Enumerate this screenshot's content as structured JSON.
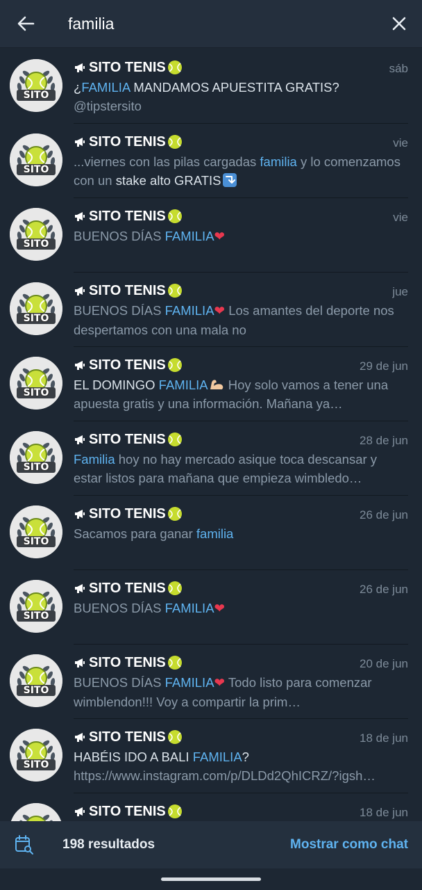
{
  "header": {
    "search_value": "familia",
    "back_icon": "arrow-left-icon",
    "close_icon": "close-icon"
  },
  "results": [
    {
      "chat_name": "SITO TENIS",
      "date": "sáb",
      "avatar_text": "SITO",
      "parts": [
        {
          "t": "¿",
          "c": "white"
        },
        {
          "t": "FAMILIA",
          "c": "hl"
        },
        {
          "t": " MANDAMOS APUESTITA GRATIS?",
          "c": "white"
        },
        {
          "t": " @tipstersito",
          "c": ""
        }
      ]
    },
    {
      "chat_name": "SITO TENIS",
      "date": "vie",
      "avatar_text": "SITO",
      "parts": [
        {
          "t": "...viernes con las pilas cargadas ",
          "c": ""
        },
        {
          "t": "familia",
          "c": "hl"
        },
        {
          "t": " y lo comenzamos con un ",
          "c": ""
        },
        {
          "t": "stake alto GRATIS",
          "c": "white"
        },
        {
          "t": "",
          "c": "arrow"
        }
      ]
    },
    {
      "chat_name": "SITO TENIS",
      "date": "vie",
      "avatar_text": "SITO",
      "parts": [
        {
          "t": "BUENOS DÍAS ",
          "c": ""
        },
        {
          "t": "FAMILIA",
          "c": "hl"
        },
        {
          "t": "❤",
          "c": "heart"
        }
      ]
    },
    {
      "chat_name": "SITO TENIS",
      "date": "jue",
      "avatar_text": "SITO",
      "parts": [
        {
          "t": "BUENOS DÍAS ",
          "c": ""
        },
        {
          "t": "FAMILIA",
          "c": "hl"
        },
        {
          "t": "❤",
          "c": "heart"
        },
        {
          "t": "  Los amantes del deporte nos despertamos con una mala no",
          "c": ""
        }
      ]
    },
    {
      "chat_name": "SITO TENIS",
      "date": "29 de jun",
      "avatar_text": "SITO",
      "parts": [
        {
          "t": " EL DOMINGO ",
          "c": "white"
        },
        {
          "t": "FAMILIA",
          "c": "hl"
        },
        {
          "t": "",
          "c": "muscle"
        },
        {
          "t": "  Hoy solo vamos a tener una apuesta gratis y una información. Mañana ya…",
          "c": ""
        }
      ]
    },
    {
      "chat_name": "SITO TENIS",
      "date": "28 de jun",
      "avatar_text": "SITO",
      "parts": [
        {
          "t": "Familia",
          "c": "hl"
        },
        {
          "t": " hoy no hay mercado asique toca descansar y estar listos para mañana que empieza wimbledo…",
          "c": ""
        }
      ]
    },
    {
      "chat_name": "SITO TENIS",
      "date": "26 de jun",
      "avatar_text": "SITO",
      "parts": [
        {
          "t": "Sacamos para ganar ",
          "c": ""
        },
        {
          "t": "familia",
          "c": "hl"
        }
      ]
    },
    {
      "chat_name": "SITO TENIS",
      "date": "26 de jun",
      "avatar_text": "SITO",
      "parts": [
        {
          "t": "BUENOS DÍAS ",
          "c": ""
        },
        {
          "t": "FAMILIA",
          "c": "hl"
        },
        {
          "t": "❤",
          "c": "heart"
        }
      ]
    },
    {
      "chat_name": "SITO TENIS",
      "date": "20 de jun",
      "avatar_text": "SITO",
      "parts": [
        {
          "t": "BUENOS DÍAS ",
          "c": ""
        },
        {
          "t": "FAMILIA",
          "c": "hl"
        },
        {
          "t": "❤",
          "c": "heart"
        },
        {
          "t": "  Todo listo para comenzar wimblendon!!! Voy a compartir la prim…",
          "c": ""
        }
      ]
    },
    {
      "chat_name": "SITO TENIS",
      "date": "18 de jun",
      "avatar_text": "SITO",
      "parts": [
        {
          "t": "HABÉIS IDO A BALI ",
          "c": "white"
        },
        {
          "t": "FAMILIA",
          "c": "hl"
        },
        {
          "t": "?",
          "c": "white"
        },
        {
          "t": "  https://www.instagram.com/p/DLDd2QhICRZ/?igsh…",
          "c": ""
        }
      ]
    },
    {
      "chat_name": "SITO TENIS",
      "date": "18 de jun",
      "avatar_text": "SITO",
      "parts": []
    }
  ],
  "bottom_bar": {
    "count_label": "198 resultados",
    "show_as_chat_label": "Mostrar como chat",
    "calendar_icon": "calendar-search-icon"
  },
  "colors": {
    "background": "#1d2733",
    "header": "#242f3d",
    "accent": "#5fb3f0",
    "muted_text": "#8b9aa9"
  }
}
